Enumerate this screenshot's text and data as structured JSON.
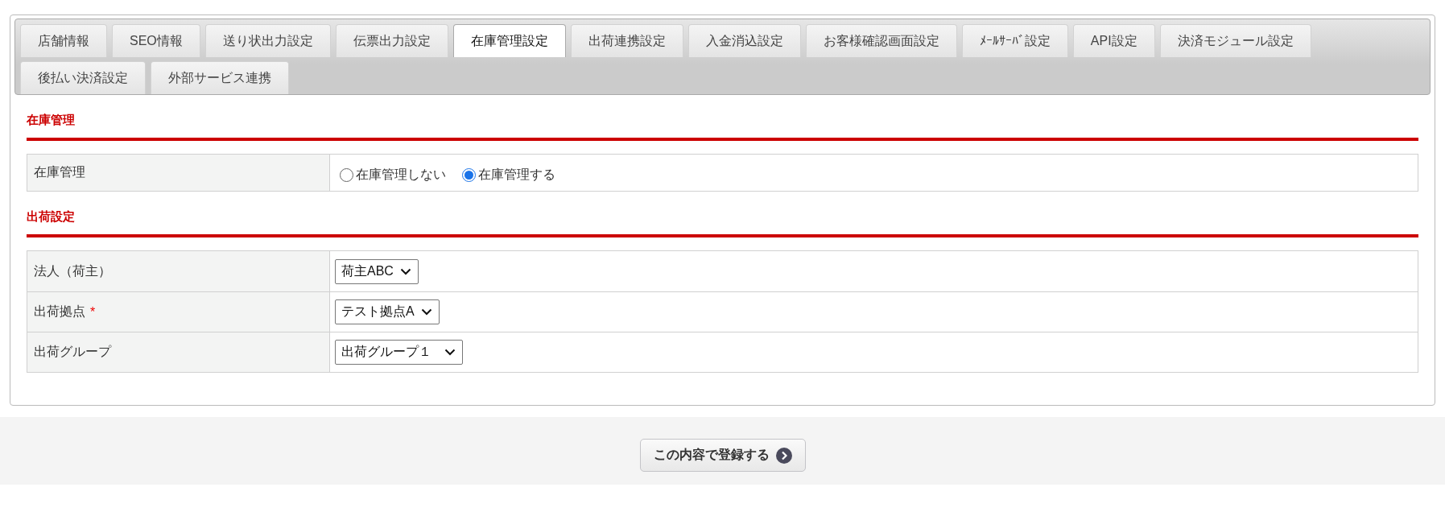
{
  "tabs": [
    {
      "label": "店舗情報",
      "selected": false
    },
    {
      "label": "SEO情報",
      "selected": false
    },
    {
      "label": "送り状出力設定",
      "selected": false
    },
    {
      "label": "伝票出力設定",
      "selected": false
    },
    {
      "label": "在庫管理設定",
      "selected": true
    },
    {
      "label": "出荷連携設定",
      "selected": false
    },
    {
      "label": "入金消込設定",
      "selected": false
    },
    {
      "label": "お客様確認画面設定",
      "selected": false
    },
    {
      "label": "ﾒｰﾙｻｰﾊﾞ設定",
      "selected": false
    },
    {
      "label": "API設定",
      "selected": false
    },
    {
      "label": "決済モジュール設定",
      "selected": false
    },
    {
      "label": "後払い決済設定",
      "selected": false
    },
    {
      "label": "外部サービス連携",
      "selected": false
    }
  ],
  "sections": [
    {
      "title": "在庫管理",
      "rows": [
        {
          "kind": "radio",
          "label": "在庫管理",
          "options": [
            {
              "label": "在庫管理しない",
              "selected": false
            },
            {
              "label": "在庫管理する",
              "selected": true
            }
          ]
        }
      ]
    },
    {
      "title": "出荷設定",
      "rows": [
        {
          "kind": "select",
          "label": "法人（荷主）",
          "value": "荷主ABC"
        },
        {
          "kind": "select",
          "label": "出荷拠点",
          "required_mark": "*",
          "value": "テスト拠点A"
        },
        {
          "kind": "select",
          "label": "出荷グループ",
          "value": "出荷グループ１"
        }
      ]
    }
  ],
  "submit_button": {
    "label": "この内容で登録する"
  }
}
